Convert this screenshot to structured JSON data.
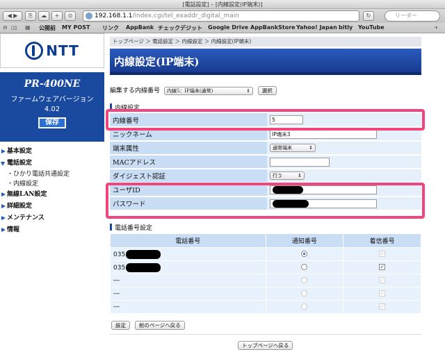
{
  "browser": {
    "window_title": "[電話設定] – [内線設定(IP端末)]",
    "url_host": "192.168.1.1",
    "url_path": "/index.cgi/tel_exaddr_digital_main",
    "search_placeholder": "リーダー",
    "bookmarks": [
      "公開前",
      "MY POST",
      "リンク",
      "AppBank",
      "チェックデジット",
      "Google Drive",
      "AppBankStore",
      "Yahoo! Japan",
      "bitly",
      "YouTube"
    ]
  },
  "sidebar": {
    "logo_text": "NTT",
    "model": "PR-400NE",
    "firmware_label": "ファームウェアバージョン",
    "firmware_version": "4.02",
    "save_label": "保存",
    "menu": [
      {
        "label": "基本設定"
      },
      {
        "label": "電話設定"
      },
      {
        "label": "無線LAN設定"
      },
      {
        "label": "詳細設定"
      },
      {
        "label": "メンテナンス"
      },
      {
        "label": "情報"
      }
    ],
    "submenu": [
      "・ひかり電話共通設定",
      "・内線設定"
    ]
  },
  "main": {
    "breadcrumb": "トップページ ＞ 電話設定 ＞ 内線設定 ＞ 内線設定(IP端末)",
    "title": "内線設定(IP端末)",
    "edit_label": "編集する内線番号",
    "edit_select": "内線5：IP端末(通常)",
    "select_button": "選択",
    "ext_section": "内線設定",
    "fields": {
      "ext_number": {
        "label": "内線番号",
        "value": "5"
      },
      "nickname": {
        "label": "ニックネーム",
        "value": "IP端末3"
      },
      "terminal_type": {
        "label": "端末属性",
        "value": "通常端末"
      },
      "mac": {
        "label": "MACアドレス",
        "value": ""
      },
      "digest": {
        "label": "ダイジェスト認証",
        "value": "行う"
      },
      "user_id": {
        "label": "ユーザID"
      },
      "password": {
        "label": "パスワード"
      }
    },
    "phone_section": "電話番号設定",
    "phone_table": {
      "headers": [
        "電話番号",
        "通知番号",
        "着信番号"
      ],
      "rows": [
        {
          "number": "035",
          "redacted": true,
          "notify": "selected",
          "incoming": "checked-disabled"
        },
        {
          "number": "035",
          "redacted": true,
          "notify": "unselected",
          "incoming": "checked"
        },
        {
          "number": "―",
          "redacted": false,
          "notify": "disabled",
          "incoming": "checked-disabled"
        },
        {
          "number": "―",
          "redacted": false,
          "notify": "disabled",
          "incoming": "checked-disabled"
        },
        {
          "number": "―",
          "redacted": false,
          "notify": "disabled",
          "incoming": "checked-disabled"
        }
      ]
    },
    "settings_button": "設定",
    "back_button": "前のページへ戻る",
    "top_button": "トップページへ戻る"
  }
}
